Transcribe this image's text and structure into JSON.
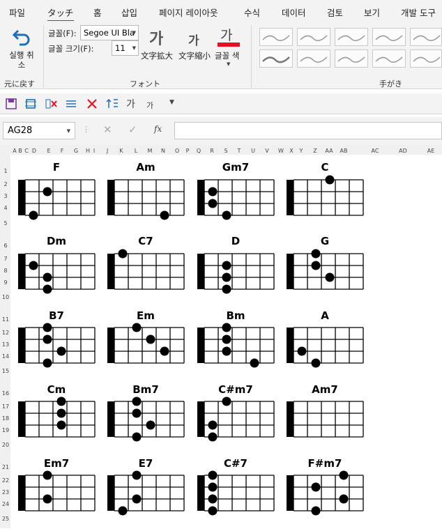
{
  "tabs": [
    "파일",
    "タッチ",
    "홈",
    "삽입",
    "페이지 레이아웃",
    "수식",
    "데이터",
    "검토",
    "보기",
    "개발 도구"
  ],
  "active_tab": "タッチ",
  "ribbon": {
    "undo_label": "실행 취소",
    "undo_group": "元に戻す",
    "font_label": "글꼴(F):",
    "font_value": "Segoe UI Bla",
    "size_label": "글꼴 크기(F):",
    "size_value": "11",
    "grow_label": "文字拡大",
    "shrink_label": "文字縮小",
    "font_color_label": "글꼴 색",
    "font_group": "フォント",
    "ink_group": "手がき",
    "glyph": "가",
    "font_color_swatch": "#e81123"
  },
  "formula_bar": {
    "name_box": "AG28",
    "fx": "fx",
    "formula": ""
  },
  "columns": [
    "A",
    "B",
    "C",
    "D",
    "E",
    "F",
    "G",
    "H",
    "I",
    "J",
    "K",
    "L",
    "M",
    "N",
    "O",
    "P",
    "Q",
    "R",
    "S",
    "T",
    "U",
    "V",
    "W",
    "X",
    "Y",
    "Z",
    "AA",
    "AB",
    "AC",
    "AD",
    "AE"
  ],
  "rows": [
    "1",
    "2",
    "3",
    "4",
    "5",
    "6",
    "7",
    "8",
    "9",
    "10",
    "11",
    "12",
    "13",
    "14",
    "15",
    "16",
    "17",
    "18",
    "19",
    "20",
    "21",
    "22",
    "23",
    "24",
    "25"
  ],
  "chords": [
    {
      "name": "F",
      "dots": [
        [
          2,
          1
        ],
        [
          1,
          3
        ]
      ]
    },
    {
      "name": "Am",
      "dots": [
        [
          4,
          3
        ]
      ]
    },
    {
      "name": "Gm7",
      "dots": [
        [
          1,
          1
        ],
        [
          1,
          2
        ],
        [
          2,
          3
        ]
      ]
    },
    {
      "name": "C",
      "dots": [
        [
          3,
          0
        ]
      ]
    },
    {
      "name": "Dm",
      "dots": [
        [
          1,
          1
        ],
        [
          2,
          2
        ],
        [
          2,
          3
        ]
      ]
    },
    {
      "name": "C7",
      "dots": [
        [
          1,
          0
        ]
      ]
    },
    {
      "name": "D",
      "dots": [
        [
          2,
          1
        ],
        [
          2,
          2
        ],
        [
          2,
          3
        ]
      ]
    },
    {
      "name": "G",
      "dots": [
        [
          2,
          1
        ],
        [
          3,
          2
        ],
        [
          2,
          0
        ]
      ]
    },
    {
      "name": "B7",
      "dots": [
        [
          2,
          0
        ],
        [
          2,
          1
        ],
        [
          3,
          2
        ],
        [
          2,
          3
        ]
      ]
    },
    {
      "name": "Em",
      "dots": [
        [
          2,
          0
        ],
        [
          3,
          1
        ],
        [
          4,
          2
        ]
      ]
    },
    {
      "name": "Bm",
      "dots": [
        [
          2,
          0
        ],
        [
          2,
          1
        ],
        [
          2,
          2
        ],
        [
          4,
          3
        ]
      ]
    },
    {
      "name": "A",
      "dots": [
        [
          1,
          2
        ],
        [
          2,
          3
        ]
      ]
    },
    {
      "name": "Cm",
      "dots": [
        [
          3,
          0
        ],
        [
          3,
          1
        ],
        [
          3,
          2
        ]
      ]
    },
    {
      "name": "Bm7",
      "dots": [
        [
          2,
          0
        ],
        [
          2,
          1
        ],
        [
          3,
          2
        ],
        [
          2,
          3
        ]
      ]
    },
    {
      "name": "C#m7",
      "dots": [
        [
          2,
          0
        ],
        [
          1,
          2
        ],
        [
          1,
          3
        ]
      ]
    },
    {
      "name": "Am7",
      "dots": []
    },
    {
      "name": "Em7",
      "dots": [
        [
          2,
          0
        ],
        [
          2,
          2
        ]
      ]
    },
    {
      "name": "E7",
      "dots": [
        [
          2,
          0
        ],
        [
          2,
          2
        ],
        [
          1,
          3
        ]
      ]
    },
    {
      "name": "C#7",
      "dots": [
        [
          1,
          0
        ],
        [
          1,
          1
        ],
        [
          1,
          2
        ],
        [
          1,
          3
        ]
      ]
    },
    {
      "name": "F#m7",
      "dots": [
        [
          4,
          0
        ],
        [
          2,
          1
        ],
        [
          4,
          2
        ],
        [
          2,
          3
        ]
      ]
    }
  ]
}
